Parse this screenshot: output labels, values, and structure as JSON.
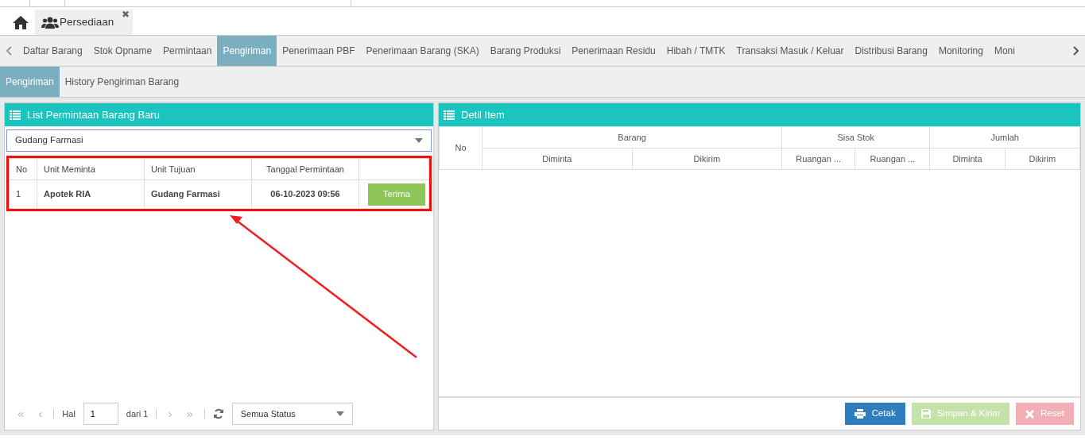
{
  "app_tabs": [
    {
      "kind": "home",
      "selected": false
    },
    {
      "kind": "page",
      "label": "Persediaan",
      "selected": true,
      "close": "✖"
    }
  ],
  "menu_tabs": [
    {
      "label": "Daftar Barang",
      "selected": false
    },
    {
      "label": "Stok Opname",
      "selected": false
    },
    {
      "label": "Permintaan",
      "selected": false
    },
    {
      "label": "Pengiriman",
      "selected": true
    },
    {
      "label": "Penerimaan PBF",
      "selected": false
    },
    {
      "label": "Penerimaan Barang (SKA)",
      "selected": false
    },
    {
      "label": "Barang Produksi",
      "selected": false
    },
    {
      "label": "Penerimaan Residu",
      "selected": false
    },
    {
      "label": "Hibah / TMTK",
      "selected": false
    },
    {
      "label": "Transaksi Masuk / Keluar",
      "selected": false
    },
    {
      "label": "Distribusi Barang",
      "selected": false
    },
    {
      "label": "Monitoring",
      "selected": false
    },
    {
      "label": "Moni",
      "selected": false
    }
  ],
  "sub_tabs": [
    {
      "label": "Pengiriman",
      "selected": true
    },
    {
      "label": "History Pengiriman Barang",
      "selected": false
    }
  ],
  "left_panel": {
    "title": "List Permintaan Barang Baru",
    "filter": "Gudang Farmasi",
    "arrow": true,
    "table": {
      "highlighted": true,
      "columns": [
        "No",
        "Unit Meminta",
        "Unit Tujuan",
        "Tanggal Permintaan"
      ],
      "rows": [
        {
          "no": "1",
          "unit_meminta": "Apotek RIA",
          "unit_tujuan": "Gudang Farmasi",
          "tanggal": "06-10-2023 09:56",
          "action": "Terima"
        }
      ]
    },
    "pager": {
      "first": "«",
      "prev": "‹",
      "next": "›",
      "last": "»",
      "first_disabled": true,
      "prev_disabled": true,
      "next_disabled": true,
      "last_disabled": true,
      "page_label": "Hal",
      "page": "1",
      "of": "dari 1",
      "status": "Semua Status"
    }
  },
  "right_panel": {
    "title": "Detil Item",
    "no_header": "No",
    "groups": [
      {
        "label": "Barang",
        "columns": [
          "Diminta",
          "Dikirim"
        ]
      },
      {
        "label": "Sisa Stok",
        "columns": [
          "Ruangan ...",
          "Ruangan ..."
        ]
      },
      {
        "label": "Jumlah",
        "columns": [
          "Diminta",
          "Dikirim"
        ]
      }
    ],
    "buttons": [
      {
        "kind": "print",
        "label": "Cetak",
        "disabled": false
      },
      {
        "kind": "save",
        "label": "Simpan & Kirim",
        "disabled": true
      },
      {
        "kind": "reset",
        "label": "Reset",
        "disabled": true
      }
    ]
  }
}
